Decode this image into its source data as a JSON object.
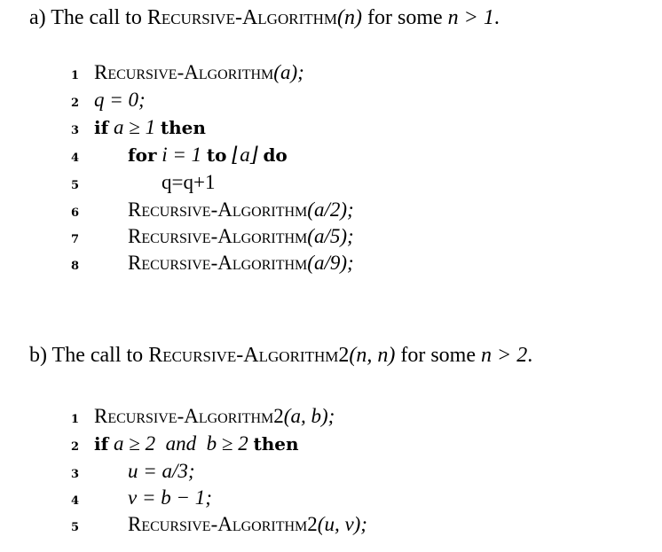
{
  "part_a": {
    "heading": {
      "prefix": "a) The call to ",
      "name": "Recursive-Algorithm",
      "args": "(n)",
      "suffix_text": " for some ",
      "condition": "n > 1",
      "end": "."
    },
    "lines": [
      {
        "num": "1",
        "text": "Recursive-Algorithm",
        "args": "(a);"
      },
      {
        "num": "2",
        "text": "q = 0;"
      },
      {
        "num": "3",
        "kw1": "if",
        "expr": "a ≥ 1",
        "kw2": "then"
      },
      {
        "num": "4",
        "kw1": "for",
        "expr1": "i = 1",
        "kw2": "to",
        "expr2": "⌊a⌋",
        "kw3": "do"
      },
      {
        "num": "5",
        "text": "q=q+1"
      },
      {
        "num": "6",
        "text": "Recursive-Algorithm",
        "args": "(a/2);"
      },
      {
        "num": "7",
        "text": "Recursive-Algorithm",
        "args": "(a/5);"
      },
      {
        "num": "8",
        "text": "Recursive-Algorithm",
        "args": "(a/9);"
      }
    ]
  },
  "part_b": {
    "heading": {
      "prefix": "b) The call to ",
      "name": "Recursive-Algorithm2",
      "args": "(n, n)",
      "suffix_text": " for some ",
      "condition": "n > 2",
      "end": "."
    },
    "lines": [
      {
        "num": "1",
        "text": "Recursive-Algorithm2",
        "args": "(a, b);"
      },
      {
        "num": "2",
        "kw1": "if",
        "expr1": "a ≥ 2",
        "and": "and",
        "expr2": "b ≥ 2",
        "kw2": "then"
      },
      {
        "num": "3",
        "text": "u = a/3;"
      },
      {
        "num": "4",
        "text": "v = b − 1;"
      },
      {
        "num": "5",
        "text": "Recursive-Algorithm2",
        "args": "(u, v);"
      }
    ]
  }
}
